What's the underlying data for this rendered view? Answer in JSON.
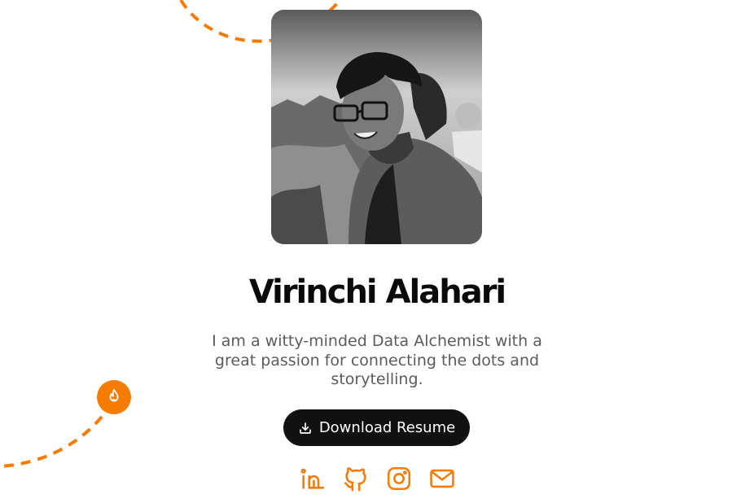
{
  "profile": {
    "name": "Virinchi Alahari",
    "bio": "I am a witty-minded Data Alchemist with a great passion for connecting the dots and storytelling.",
    "photo_alt": "Portrait photo"
  },
  "actions": {
    "download_label": "Download Resume"
  },
  "social": [
    {
      "name": "linkedin-icon"
    },
    {
      "name": "github-icon"
    },
    {
      "name": "instagram-icon"
    },
    {
      "name": "mail-icon"
    }
  ],
  "colors": {
    "accent": "#f57c00",
    "text": "#0a0a0a",
    "muted": "#5b5b5b",
    "button": "#111111"
  }
}
